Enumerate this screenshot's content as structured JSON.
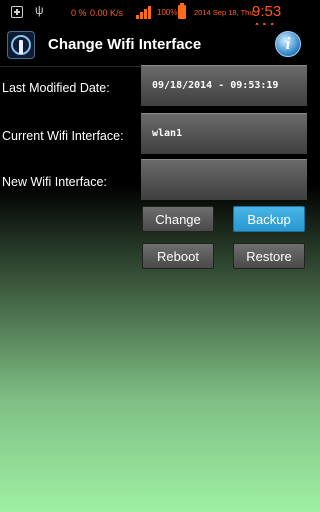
{
  "statusbar": {
    "battery_pct_text": "0 %",
    "speed": "0.00 K/s",
    "battery_level": "100%",
    "date": "2014 Sep 18, Thu",
    "time": "9:53 AM"
  },
  "actionbar": {
    "title": "Change Wifi Interface",
    "info_glyph": "i"
  },
  "form": {
    "last_modified_label": "Last Modified Date:",
    "last_modified_value": "09/18/2014 - 09:53:19",
    "current_label": "Current Wifi Interface:",
    "current_value": "wlan1",
    "new_label": "New Wifi Interface:",
    "new_value": ""
  },
  "buttons": {
    "change": "Change",
    "backup": "Backup",
    "reboot": "Reboot",
    "restore": "Restore"
  },
  "colors": {
    "accent": "#2a96cf",
    "status_text": "#ff5a1a"
  }
}
